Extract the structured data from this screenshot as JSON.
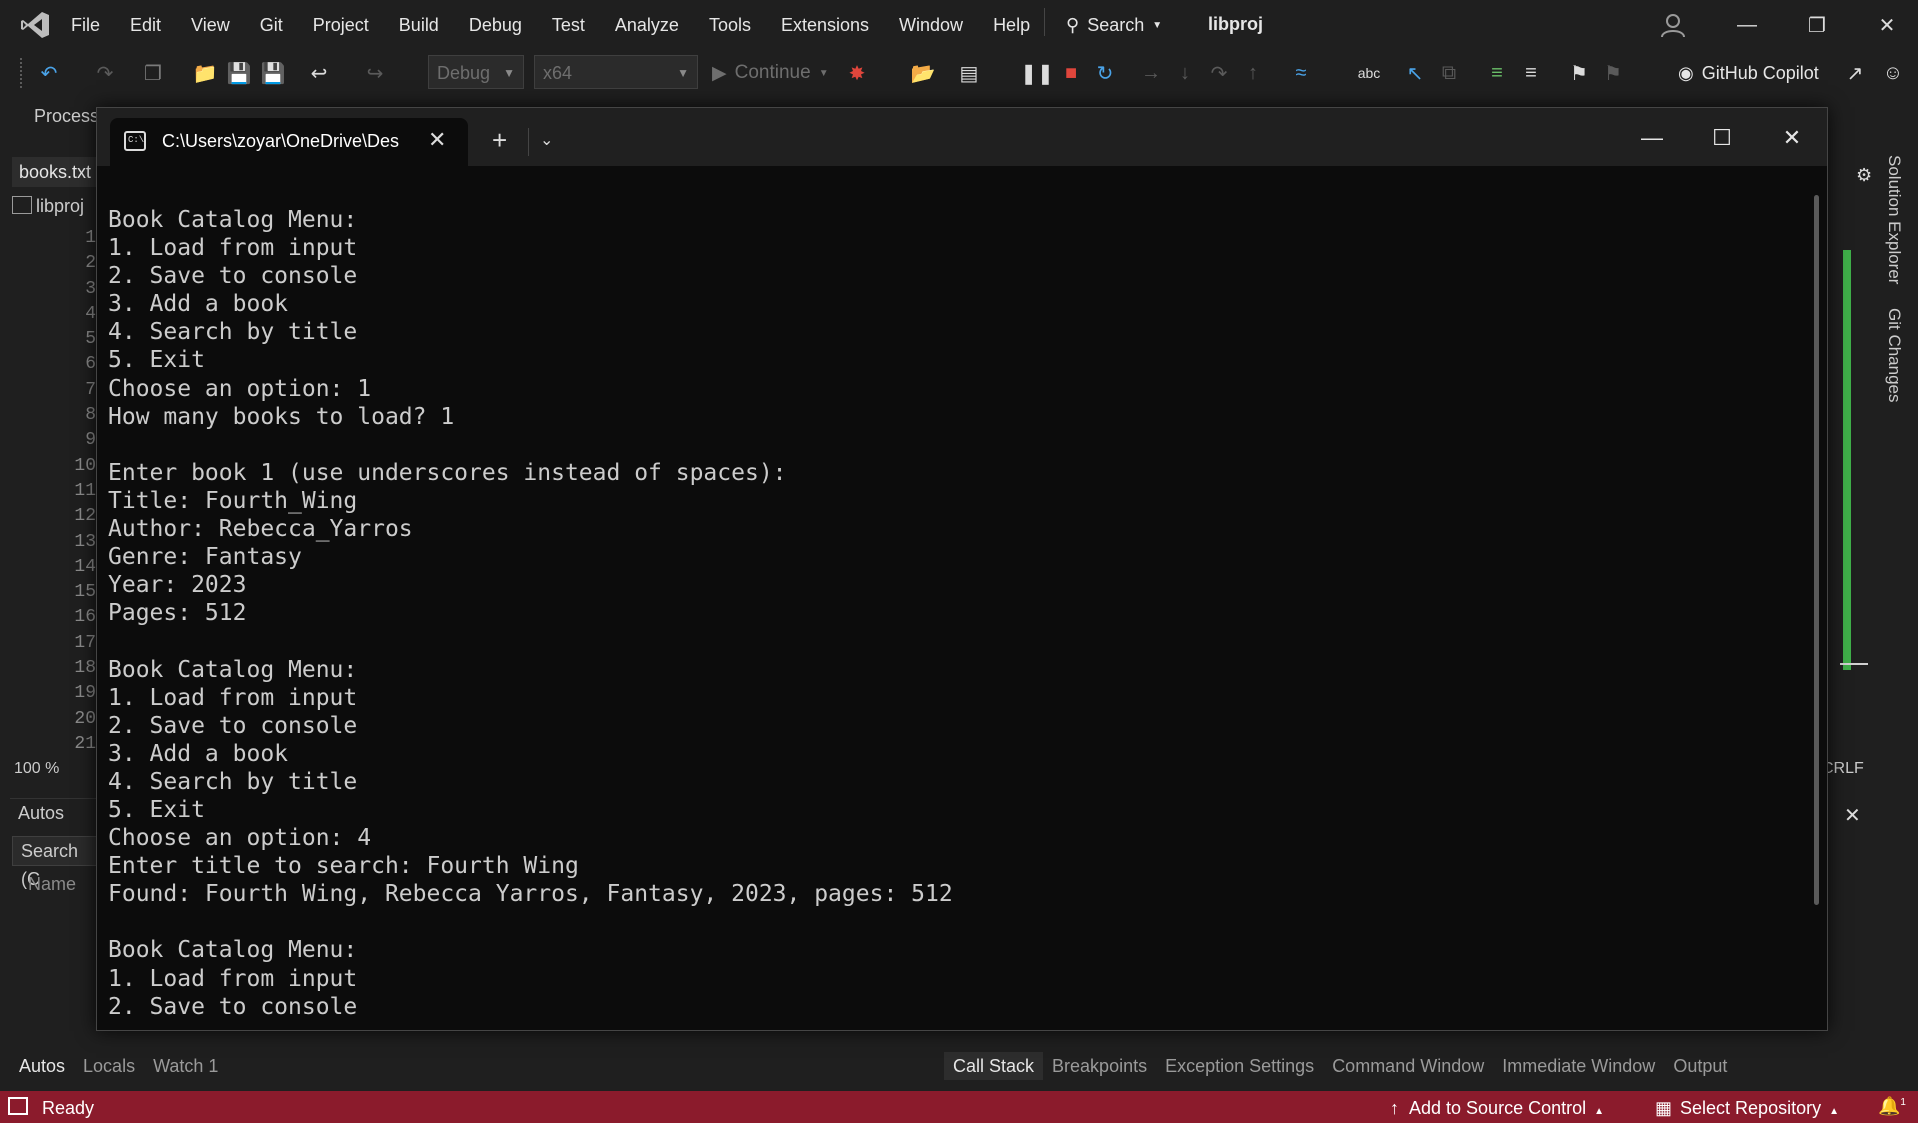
{
  "menubar": {
    "items": [
      "File",
      "Edit",
      "View",
      "Git",
      "Project",
      "Build",
      "Debug",
      "Test",
      "Analyze",
      "Tools",
      "Extensions",
      "Window",
      "Help"
    ],
    "search_label": "Search",
    "solution_name": "libproj"
  },
  "toolbar": {
    "config": "Debug",
    "platform": "x64",
    "continue_label": "Continue",
    "copilot_label": "GitHub Copilot"
  },
  "ide": {
    "process_label": "Process",
    "file_tab": "books.txt",
    "nav_project": "libproj",
    "line_numbers": [
      "1",
      "2",
      "3",
      "4",
      "5",
      "6",
      "7",
      "8",
      "9",
      "10",
      "11",
      "12",
      "13",
      "14",
      "15",
      "16",
      "17",
      "18",
      "19",
      "20",
      "21"
    ],
    "zoom": "100 %",
    "line_ending": "CRLF",
    "autos_title": "Autos",
    "autos_search": "Search (C",
    "autos_col_name": "Name",
    "right_rail": [
      "Solution Explorer",
      "Git Changes"
    ]
  },
  "bottom_tabs_left": [
    "Autos",
    "Locals",
    "Watch 1"
  ],
  "bottom_tabs_right": [
    "Call Stack",
    "Breakpoints",
    "Exception Settings",
    "Command Window",
    "Immediate Window",
    "Output"
  ],
  "statusbar": {
    "ready": "Ready",
    "source_control": "Add to Source Control",
    "select_repo": "Select Repository",
    "notifications": "1",
    "color": "#8b1b2c"
  },
  "terminal": {
    "tab_title": "C:\\Users\\zoyar\\OneDrive\\Des",
    "lines": [
      "Book Catalog Menu:",
      "1. Load from input",
      "2. Save to console",
      "3. Add a book",
      "4. Search by title",
      "5. Exit",
      "Choose an option: 1",
      "How many books to load? 1",
      "",
      "Enter book 1 (use underscores instead of spaces):",
      "Title: Fourth_Wing",
      "Author: Rebecca_Yarros",
      "Genre: Fantasy",
      "Year: 2023",
      "Pages: 512",
      "",
      "Book Catalog Menu:",
      "1. Load from input",
      "2. Save to console",
      "3. Add a book",
      "4. Search by title",
      "5. Exit",
      "Choose an option: 4",
      "Enter title to search: Fourth Wing",
      "Found: Fourth Wing, Rebecca Yarros, Fantasy, 2023, pages: 512",
      "",
      "Book Catalog Menu:",
      "1. Load from input",
      "2. Save to console"
    ]
  }
}
